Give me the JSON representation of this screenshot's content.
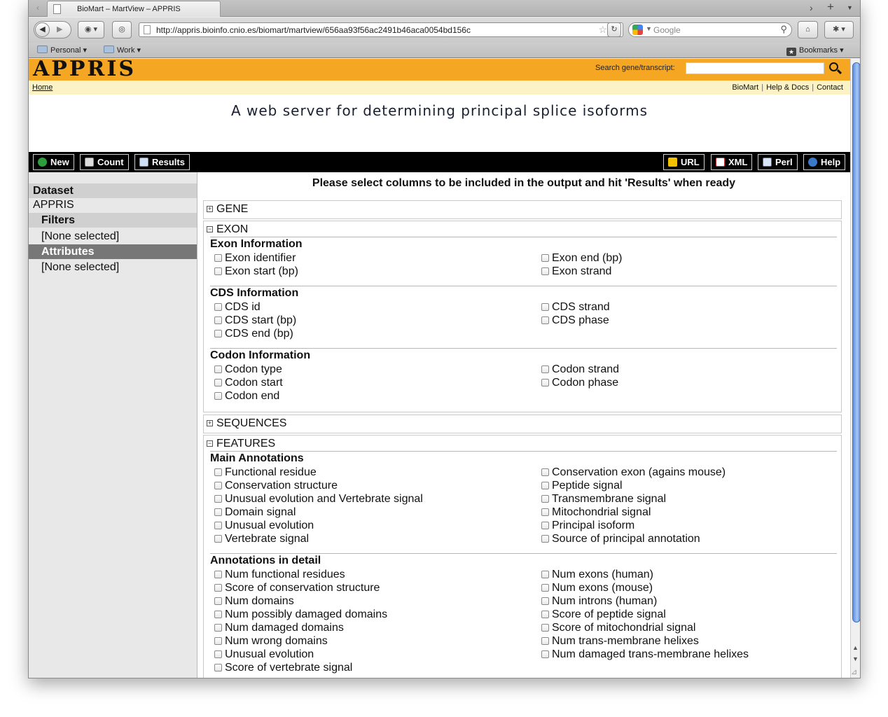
{
  "browser": {
    "tab_title": "BioMart – MartView – APPRIS",
    "url": "http://appris.bioinfo.cnio.es/biomart/martview/656aa93f56ac2491b46aca0054bd156c",
    "search_placeholder": "Google",
    "bookmarks": [
      "Personal",
      "Work"
    ],
    "bookmarks_menu": "Bookmarks"
  },
  "header": {
    "logo": "APPRIS",
    "search_label": "Search gene/transcript:",
    "home_link": "Home",
    "links": [
      "BioMart",
      "Help & Docs",
      "Contact"
    ],
    "subtitle": "A web server for determining principal splice isoforms"
  },
  "toolbar": {
    "left": [
      "New",
      "Count",
      "Results"
    ],
    "right": [
      "URL",
      "XML",
      "Perl",
      "Help"
    ]
  },
  "sidebar": {
    "dataset_label": "Dataset",
    "dataset_value": "APPRIS",
    "filters_label": "Filters",
    "filters_value": "[None selected]",
    "attributes_label": "Attributes",
    "attributes_value": "[None selected]"
  },
  "main": {
    "instruction": "Please select columns to be included in the output and hit 'Results' when ready",
    "panels": {
      "gene": {
        "title": "GENE",
        "expanded": false
      },
      "exon": {
        "title": "EXON",
        "expanded": true
      },
      "sequences": {
        "title": "SEQUENCES",
        "expanded": false
      },
      "features": {
        "title": "FEATURES",
        "expanded": true
      }
    },
    "sections": {
      "exon_info": {
        "title": "Exon Information",
        "left": [
          "Exon identifier",
          "Exon start (bp)"
        ],
        "right": [
          "Exon end (bp)",
          "Exon strand"
        ]
      },
      "cds_info": {
        "title": "CDS Information",
        "left": [
          "CDS id",
          "CDS start (bp)",
          "CDS end (bp)"
        ],
        "right": [
          "CDS strand",
          "CDS phase"
        ]
      },
      "codon_info": {
        "title": "Codon Information",
        "left": [
          "Codon type",
          "Codon start",
          "Codon end"
        ],
        "right": [
          "Codon strand",
          "Codon phase"
        ]
      },
      "main_annotations": {
        "title": "Main Annotations",
        "left": [
          "Functional residue",
          "Conservation structure",
          "Unusual evolution and Vertebrate signal",
          "Domain signal",
          "Unusual evolution",
          "Vertebrate signal"
        ],
        "right": [
          "Conservation exon (agains mouse)",
          "Peptide signal",
          "Transmembrane signal",
          "Mitochondrial signal",
          "Principal isoform",
          "Source of principal annotation"
        ]
      },
      "annotations_detail": {
        "title": "Annotations in detail",
        "left": [
          "Num functional residues",
          "Score of conservation structure",
          "Num domains",
          "Num possibly damaged domains",
          "Num damaged domains",
          "Num wrong domains",
          "Unusual evolution",
          "Score of vertebrate signal"
        ],
        "right": [
          "Num exons (human)",
          "Num exons (mouse)",
          "Num introns (human)",
          "Score of peptide signal",
          "Score of mitochondrial signal",
          "Num trans-membrane helixes",
          "Num damaged trans-membrane helixes"
        ]
      }
    }
  }
}
